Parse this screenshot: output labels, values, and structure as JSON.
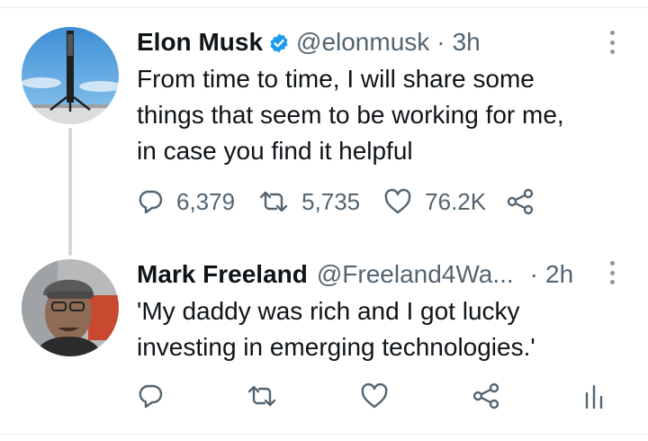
{
  "tweets": [
    {
      "name": "Elon Musk",
      "verified": true,
      "handle": "@elonmusk",
      "separator": "·",
      "time": "3h",
      "text": "From time to time, I will share some\nthings that seem to be working for me,\nin case you find it helpful",
      "replies": "6,379",
      "retweets": "5,735",
      "likes": "76.2K"
    },
    {
      "name": "Mark Freeland",
      "verified": false,
      "handle": "@Freeland4Wa...",
      "separator": "·",
      "time": "2h",
      "text": "'My daddy was rich and I got lucky\ninvesting in emerging technologies.'",
      "replies": "",
      "retweets": "",
      "likes": ""
    }
  ],
  "icons": {
    "reply": "reply-icon",
    "retweet": "retweet-icon",
    "like": "like-icon",
    "share": "share-icon",
    "analytics": "analytics-icon",
    "more": "more-options-icon",
    "verified": "verified-badge-icon"
  },
  "colors": {
    "verified_blue": "#1d9bf0",
    "icon_gray": "#536471",
    "thread_line": "#cfd9de"
  }
}
